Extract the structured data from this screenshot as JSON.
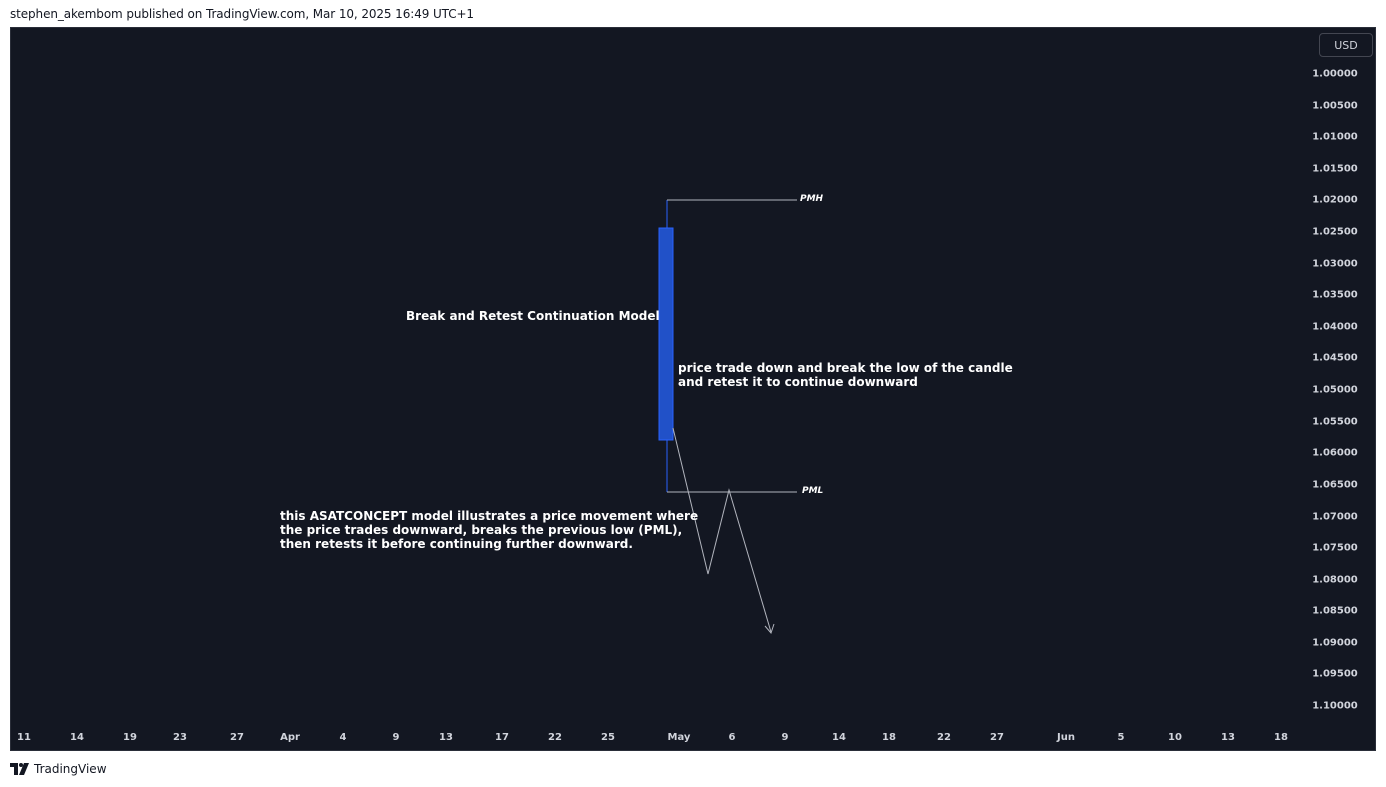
{
  "header": {
    "publisher_line": "stephen_akembom published on TradingView.com, Mar 10, 2025 16:49 UTC+1"
  },
  "chart": {
    "currency_button": "USD",
    "price_axis": [
      "1.00000",
      "1.00500",
      "1.01000",
      "1.01500",
      "1.02000",
      "1.02500",
      "1.03000",
      "1.03500",
      "1.04000",
      "1.04500",
      "1.05000",
      "1.05500",
      "1.06000",
      "1.06500",
      "1.07000",
      "1.07500",
      "1.08000",
      "1.08500",
      "1.09000",
      "1.09500",
      "1.10000"
    ],
    "time_axis": [
      "11",
      "14",
      "19",
      "23",
      "27",
      "Apr",
      "4",
      "9",
      "13",
      "17",
      "22",
      "25",
      "May",
      "6",
      "9",
      "14",
      "18",
      "22",
      "27",
      "Jun",
      "5",
      "10",
      "13",
      "18"
    ],
    "annotations": {
      "title": "Break and Retest Continuation Model",
      "candle_note_line1": "price trade down and break the low of the candle",
      "candle_note_line2": "and retest it to continue downward",
      "explanation_line1": "this ASATCONCEPT model illustrates a price movement where",
      "explanation_line2": "the price trades downward, breaks the previous low (PML),",
      "explanation_line3": "then retests it before continuing further downward.",
      "pmh_label": "PMH",
      "pml_label": "PML"
    },
    "colors": {
      "background": "#131722",
      "candle": "#2151c8",
      "wick": "#2962ff",
      "drawing_line": "#b2b5be",
      "text": "#d1d4dc"
    }
  },
  "footer": {
    "brand": "TradingView",
    "logo_icon": "tradingview-logo-icon"
  }
}
